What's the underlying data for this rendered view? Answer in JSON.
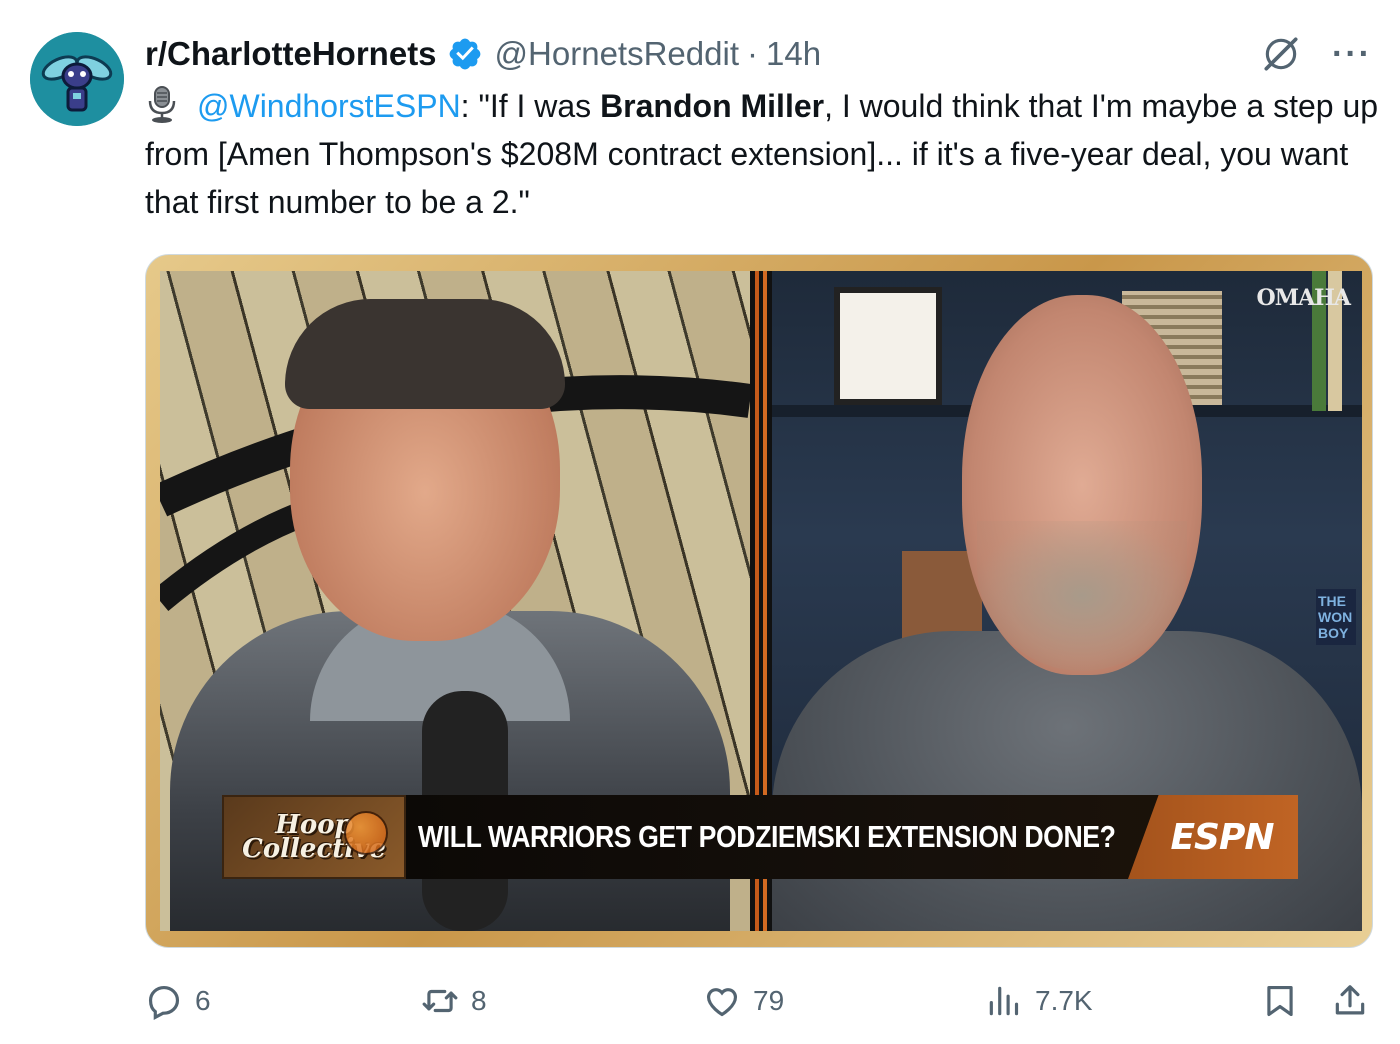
{
  "author": {
    "display_name": "r/CharlotteHornets",
    "handle": "@HornetsReddit",
    "separator": "·",
    "time": "14h"
  },
  "body": {
    "mention": "@WindhorstESPN",
    "part1": ": \"If I was ",
    "bold": "Brandon Miller",
    "part2": ", I would think that I'm maybe a step up from [Amen Thompson's $208M contract extension]... if it's a five-year deal, you want that first number to be a 2.\""
  },
  "video": {
    "headline": "WILL WARRIORS GET PODZIEMSKI EXTENSION DONE?",
    "network": "ESPN",
    "show_line1": "Hoop",
    "show_line2": "Collective",
    "corner_logo": "OMAHA",
    "book_title": "THE WON BOY"
  },
  "metrics": {
    "replies": "6",
    "reposts": "8",
    "likes": "79",
    "views": "7.7K"
  },
  "colors": {
    "accent": "#1d9bf0",
    "muted": "#536471",
    "espn_orange": "#c06424"
  },
  "icons": [
    "verified-badge-icon",
    "grok-icon",
    "more-icon",
    "podcast-mic-icon",
    "reply-icon",
    "repost-icon",
    "like-icon",
    "views-icon",
    "bookmark-icon",
    "share-icon"
  ]
}
